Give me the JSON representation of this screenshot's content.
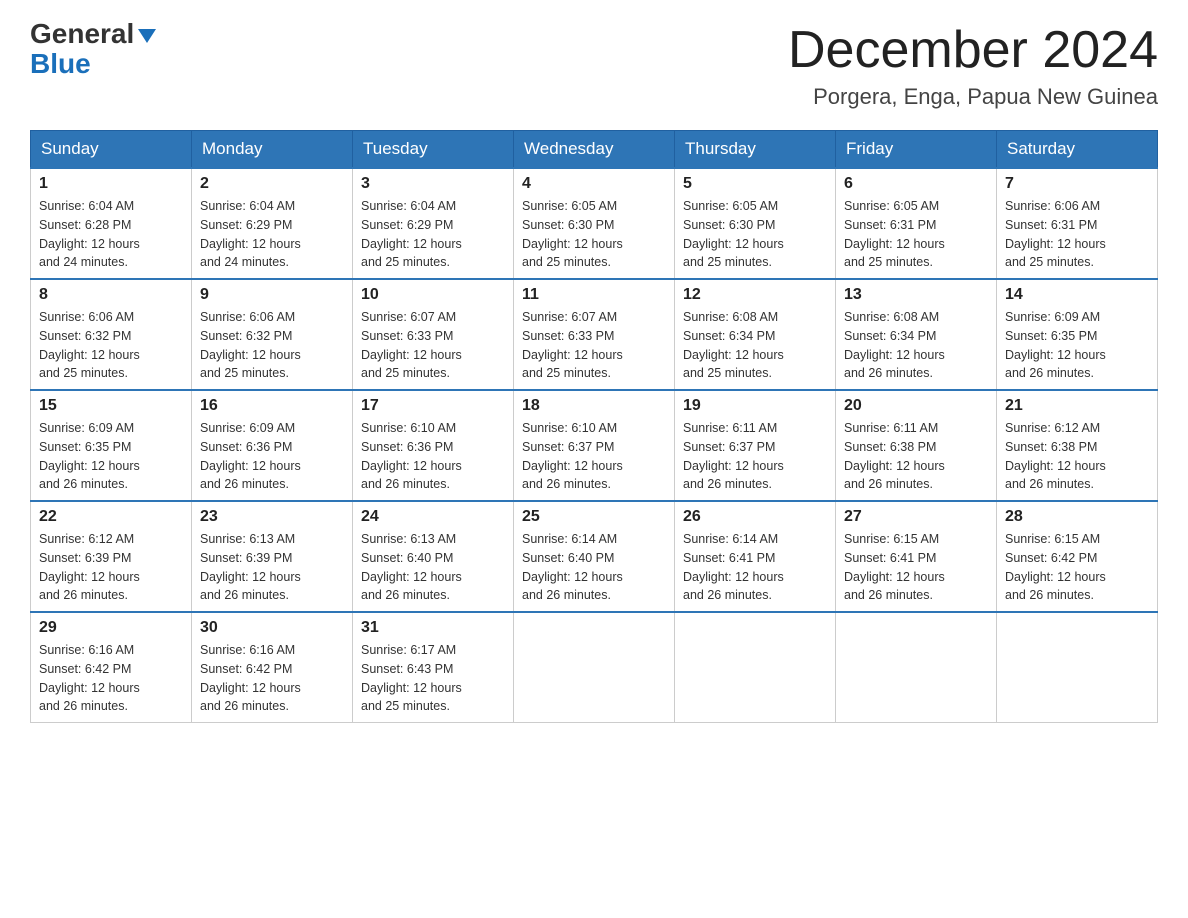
{
  "header": {
    "logo_line1": "General",
    "logo_line2": "Blue",
    "month_title": "December 2024",
    "location": "Porgera, Enga, Papua New Guinea"
  },
  "days_of_week": [
    "Sunday",
    "Monday",
    "Tuesday",
    "Wednesday",
    "Thursday",
    "Friday",
    "Saturday"
  ],
  "weeks": [
    [
      {
        "day": "1",
        "sunrise": "6:04 AM",
        "sunset": "6:28 PM",
        "daylight": "12 hours and 24 minutes."
      },
      {
        "day": "2",
        "sunrise": "6:04 AM",
        "sunset": "6:29 PM",
        "daylight": "12 hours and 24 minutes."
      },
      {
        "day": "3",
        "sunrise": "6:04 AM",
        "sunset": "6:29 PM",
        "daylight": "12 hours and 25 minutes."
      },
      {
        "day": "4",
        "sunrise": "6:05 AM",
        "sunset": "6:30 PM",
        "daylight": "12 hours and 25 minutes."
      },
      {
        "day": "5",
        "sunrise": "6:05 AM",
        "sunset": "6:30 PM",
        "daylight": "12 hours and 25 minutes."
      },
      {
        "day": "6",
        "sunrise": "6:05 AM",
        "sunset": "6:31 PM",
        "daylight": "12 hours and 25 minutes."
      },
      {
        "day": "7",
        "sunrise": "6:06 AM",
        "sunset": "6:31 PM",
        "daylight": "12 hours and 25 minutes."
      }
    ],
    [
      {
        "day": "8",
        "sunrise": "6:06 AM",
        "sunset": "6:32 PM",
        "daylight": "12 hours and 25 minutes."
      },
      {
        "day": "9",
        "sunrise": "6:06 AM",
        "sunset": "6:32 PM",
        "daylight": "12 hours and 25 minutes."
      },
      {
        "day": "10",
        "sunrise": "6:07 AM",
        "sunset": "6:33 PM",
        "daylight": "12 hours and 25 minutes."
      },
      {
        "day": "11",
        "sunrise": "6:07 AM",
        "sunset": "6:33 PM",
        "daylight": "12 hours and 25 minutes."
      },
      {
        "day": "12",
        "sunrise": "6:08 AM",
        "sunset": "6:34 PM",
        "daylight": "12 hours and 25 minutes."
      },
      {
        "day": "13",
        "sunrise": "6:08 AM",
        "sunset": "6:34 PM",
        "daylight": "12 hours and 26 minutes."
      },
      {
        "day": "14",
        "sunrise": "6:09 AM",
        "sunset": "6:35 PM",
        "daylight": "12 hours and 26 minutes."
      }
    ],
    [
      {
        "day": "15",
        "sunrise": "6:09 AM",
        "sunset": "6:35 PM",
        "daylight": "12 hours and 26 minutes."
      },
      {
        "day": "16",
        "sunrise": "6:09 AM",
        "sunset": "6:36 PM",
        "daylight": "12 hours and 26 minutes."
      },
      {
        "day": "17",
        "sunrise": "6:10 AM",
        "sunset": "6:36 PM",
        "daylight": "12 hours and 26 minutes."
      },
      {
        "day": "18",
        "sunrise": "6:10 AM",
        "sunset": "6:37 PM",
        "daylight": "12 hours and 26 minutes."
      },
      {
        "day": "19",
        "sunrise": "6:11 AM",
        "sunset": "6:37 PM",
        "daylight": "12 hours and 26 minutes."
      },
      {
        "day": "20",
        "sunrise": "6:11 AM",
        "sunset": "6:38 PM",
        "daylight": "12 hours and 26 minutes."
      },
      {
        "day": "21",
        "sunrise": "6:12 AM",
        "sunset": "6:38 PM",
        "daylight": "12 hours and 26 minutes."
      }
    ],
    [
      {
        "day": "22",
        "sunrise": "6:12 AM",
        "sunset": "6:39 PM",
        "daylight": "12 hours and 26 minutes."
      },
      {
        "day": "23",
        "sunrise": "6:13 AM",
        "sunset": "6:39 PM",
        "daylight": "12 hours and 26 minutes."
      },
      {
        "day": "24",
        "sunrise": "6:13 AM",
        "sunset": "6:40 PM",
        "daylight": "12 hours and 26 minutes."
      },
      {
        "day": "25",
        "sunrise": "6:14 AM",
        "sunset": "6:40 PM",
        "daylight": "12 hours and 26 minutes."
      },
      {
        "day": "26",
        "sunrise": "6:14 AM",
        "sunset": "6:41 PM",
        "daylight": "12 hours and 26 minutes."
      },
      {
        "day": "27",
        "sunrise": "6:15 AM",
        "sunset": "6:41 PM",
        "daylight": "12 hours and 26 minutes."
      },
      {
        "day": "28",
        "sunrise": "6:15 AM",
        "sunset": "6:42 PM",
        "daylight": "12 hours and 26 minutes."
      }
    ],
    [
      {
        "day": "29",
        "sunrise": "6:16 AM",
        "sunset": "6:42 PM",
        "daylight": "12 hours and 26 minutes."
      },
      {
        "day": "30",
        "sunrise": "6:16 AM",
        "sunset": "6:42 PM",
        "daylight": "12 hours and 26 minutes."
      },
      {
        "day": "31",
        "sunrise": "6:17 AM",
        "sunset": "6:43 PM",
        "daylight": "12 hours and 25 minutes."
      },
      null,
      null,
      null,
      null
    ]
  ],
  "labels": {
    "sunrise": "Sunrise:",
    "sunset": "Sunset:",
    "daylight": "Daylight:"
  },
  "colors": {
    "header_bg": "#2e75b6",
    "accent": "#1a6fba"
  }
}
